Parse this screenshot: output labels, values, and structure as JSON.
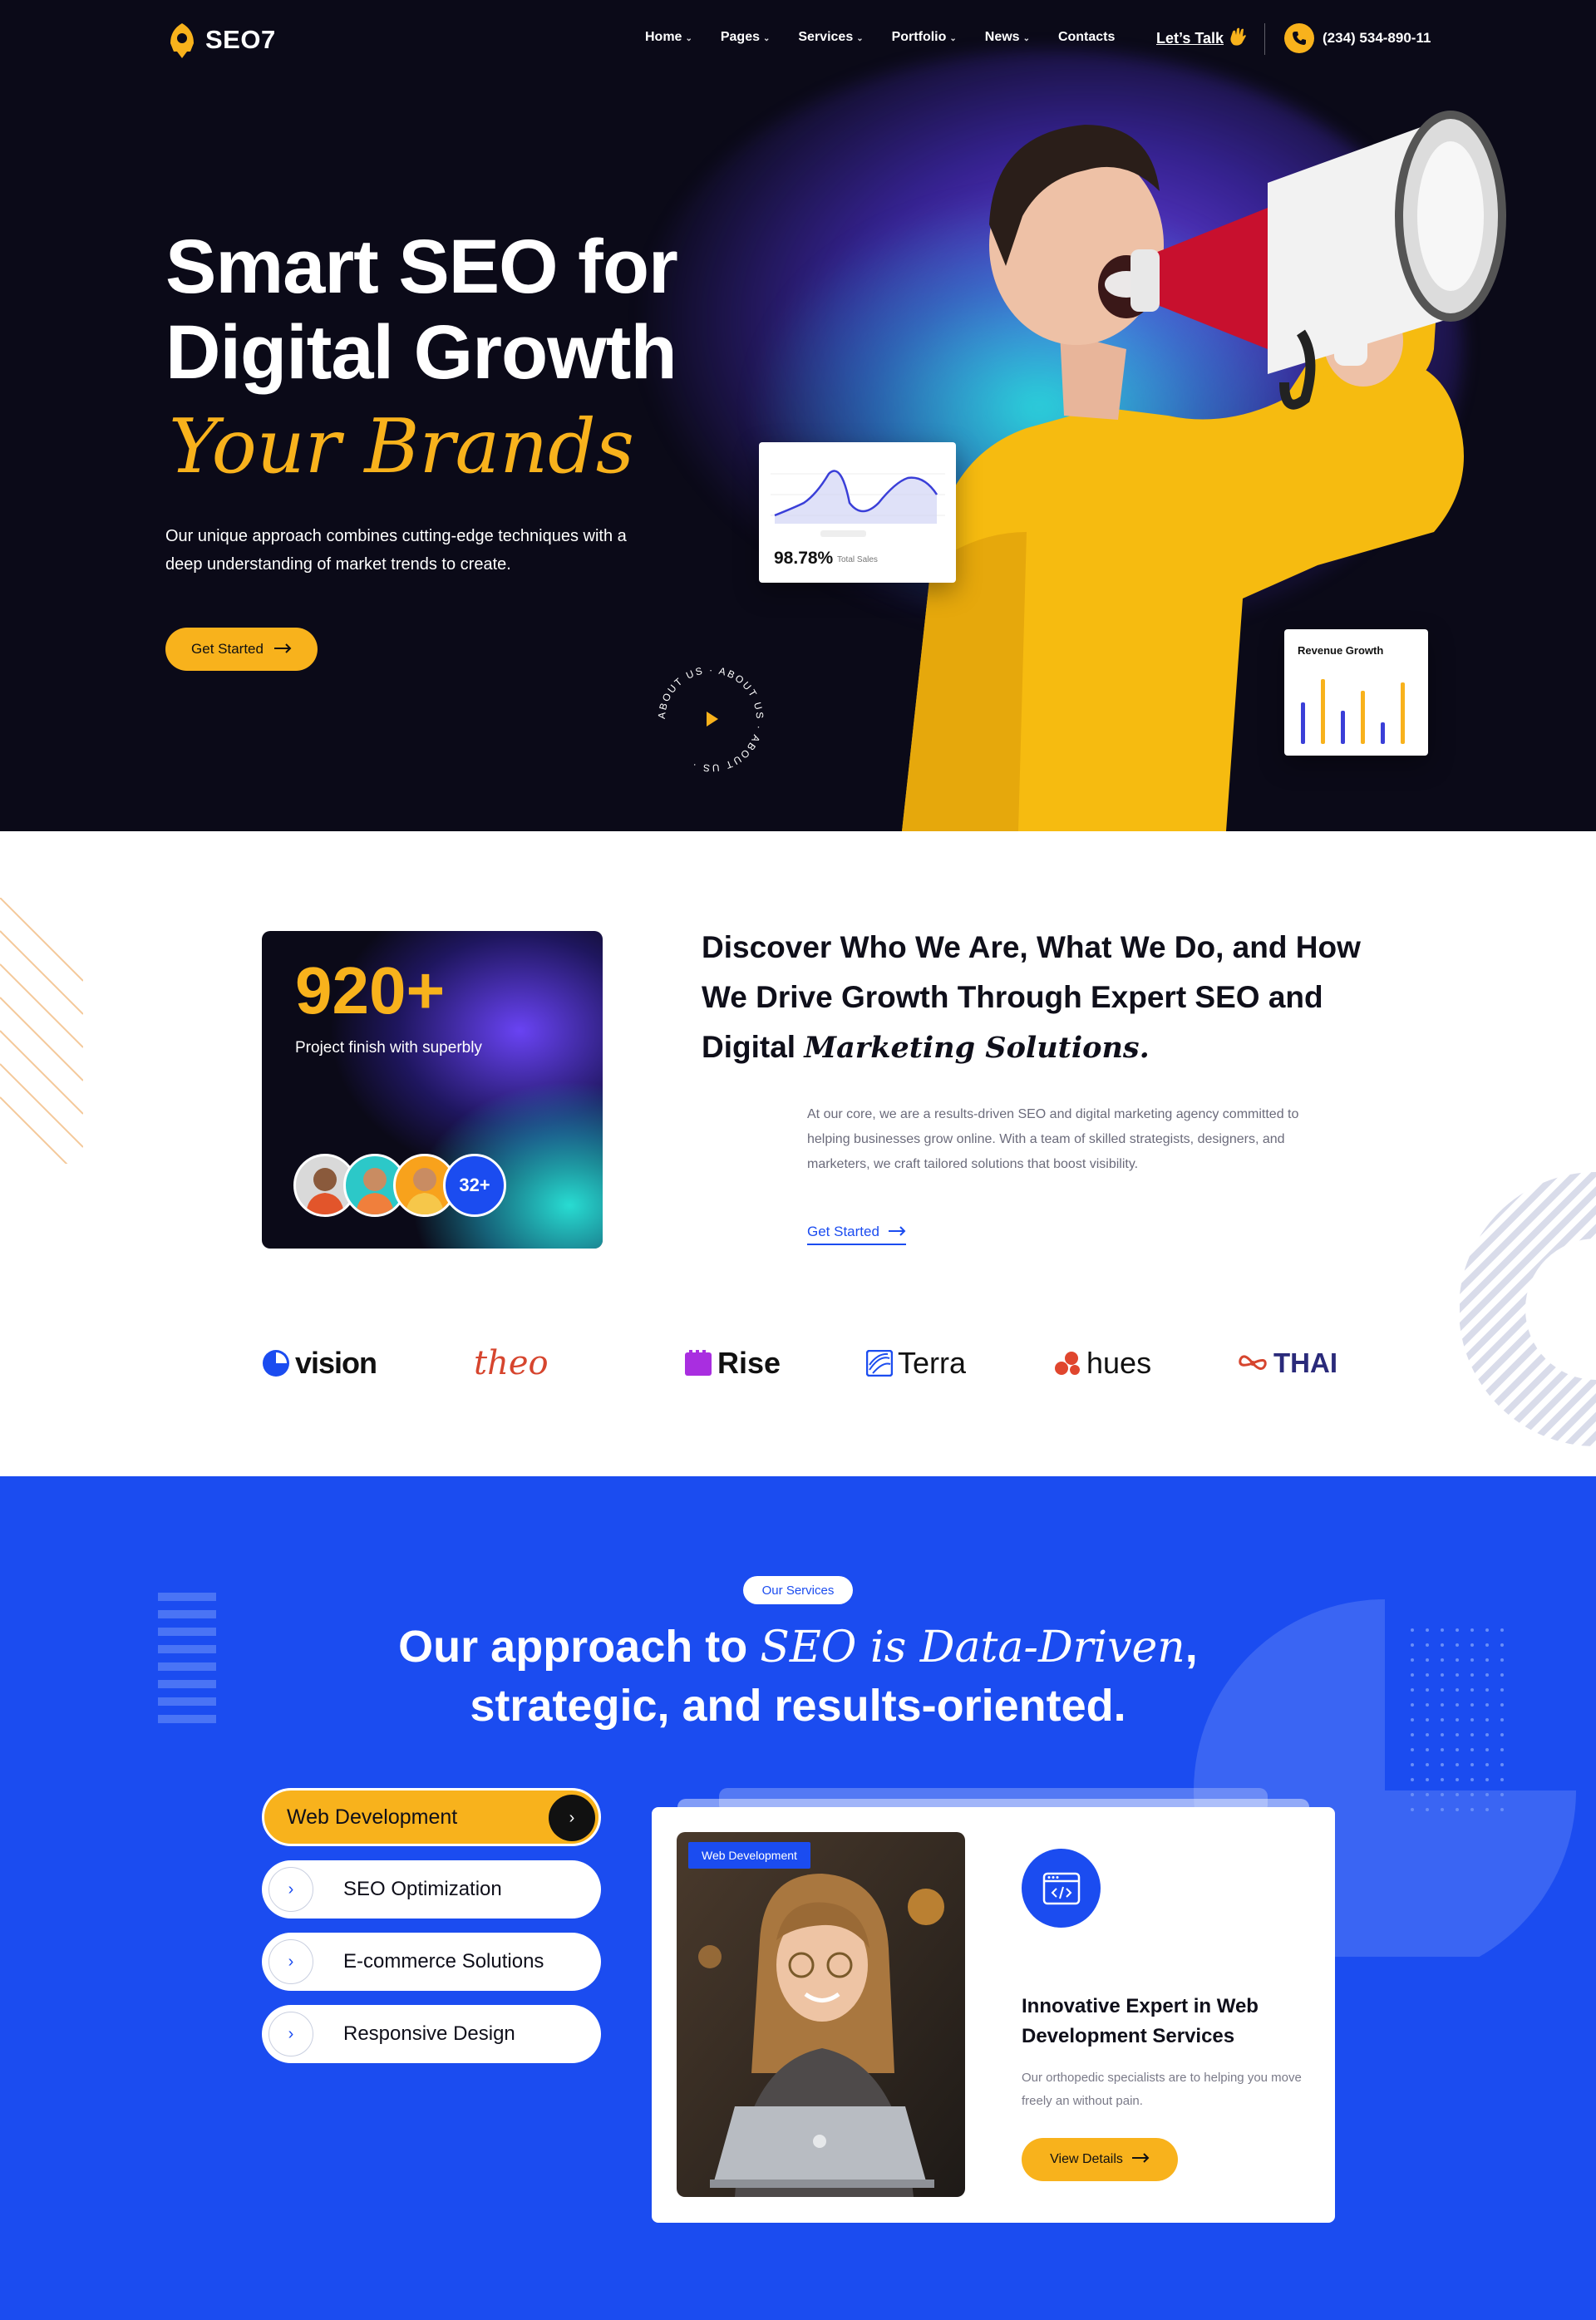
{
  "nav": {
    "logo": "SEO7",
    "menu": [
      {
        "label": "Home",
        "dropdown": true
      },
      {
        "label": "Pages",
        "dropdown": true
      },
      {
        "label": "Services",
        "dropdown": true
      },
      {
        "label": "Portfolio",
        "dropdown": true
      },
      {
        "label": "News",
        "dropdown": true
      },
      {
        "label": "Contacts",
        "dropdown": false
      }
    ],
    "cta": "Let’s Talk",
    "cta_icon": "waving-hand-icon",
    "phone": "(234) 534-890-11"
  },
  "hero": {
    "title_line1": "Smart SEO for",
    "title_line2": "Digital Growth",
    "title_accent": "Your Brands",
    "description": "Our unique approach combines cutting-edge techniques with a deep understanding of market trends to create.",
    "button": "Get Started",
    "about_ring_text": "ABOUT US · ABOUT US · ABOUT US ·",
    "sales_card": {
      "value": "98.78%",
      "label": "Total Sales"
    },
    "revenue_card": {
      "title": "Revenue Growth"
    }
  },
  "about": {
    "stat_number": "920+",
    "stat_label": "Project finish with superbly",
    "avatar_count": "32+",
    "heading_plain": "Discover Who We Are, What We Do, and How We Drive Growth Through Expert SEO and Digital",
    "heading_accent": "Marketing Solutions.",
    "text": "At our core, we are a results-driven SEO and digital marketing agency committed to helping businesses grow online. With a team of skilled strategists, designers, and marketers, we craft tailored solutions that boost visibility.",
    "link": "Get Started",
    "brands": [
      "vision",
      "theo",
      "Rise",
      "Terra",
      "hues",
      "THAI"
    ]
  },
  "services": {
    "pill": "Our Services",
    "title_plain1": "Our approach to",
    "title_accent": "SEO is Data-Driven",
    "title_plain2": ",",
    "title_line2": "strategic, and results-oriented.",
    "tabs": [
      {
        "label": "Web Development",
        "active": true
      },
      {
        "label": "SEO Optimization",
        "active": false
      },
      {
        "label": "E-commerce Solutions",
        "active": false
      },
      {
        "label": "Responsive Design",
        "active": false
      }
    ],
    "card": {
      "tag": "Web Development",
      "title": "Innovative Expert in Web Development Services",
      "text": "Our orthopedic specialists are to helping you move freely an without pain.",
      "button": "View Details"
    }
  },
  "colors": {
    "accent": "#f8b21c",
    "blue": "#1b4cf0",
    "dark": "#0b0a18"
  }
}
